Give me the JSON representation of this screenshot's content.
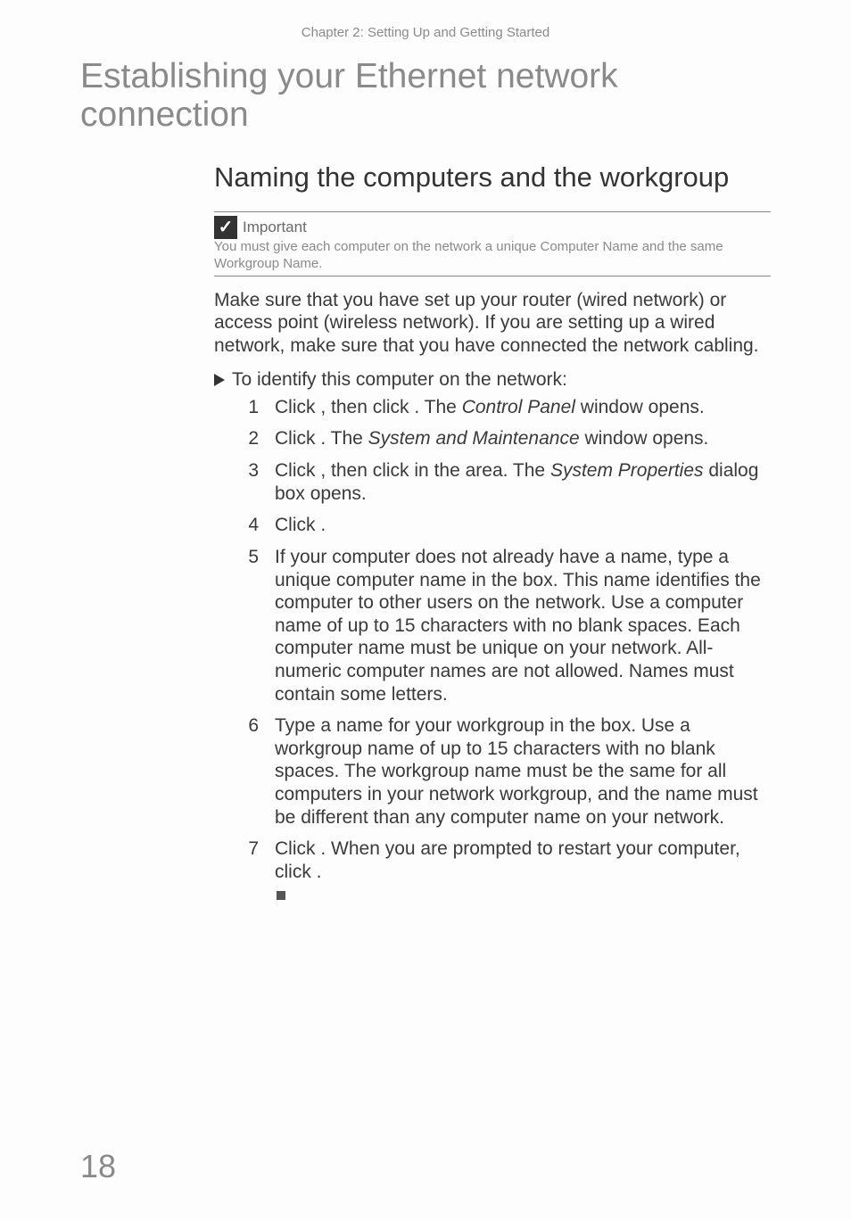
{
  "header": "Chapter 2: Setting Up and Getting Started",
  "h1": "Establishing your Ethernet network connection",
  "h2": "Naming the computers and the workgroup",
  "callout": {
    "title": "Important",
    "body": "You must give each computer on the network a unique Computer Name and the same Workgroup Name."
  },
  "intro": "Make sure that you have set up your router (wired network) or access point (wireless network). If you are setting up a wired network, make sure that you have connected the network cabling.",
  "procedure_head": "To identify this computer on the network:",
  "steps": {
    "s1_a": "Click ",
    "s1_b": ", then click ",
    "s1_c": ". The ",
    "s1_italic1": "Control Panel",
    "s1_d": " window opens.",
    "s2_a": "Click ",
    "s2_b": ". The ",
    "s2_italic1": "System and Maintenance",
    "s2_c": " window opens.",
    "s3_a": "Click ",
    "s3_b": ", then click ",
    "s3_c": " in the ",
    "s3_d": " area. The ",
    "s3_italic1": "System Properties",
    "s3_e": " dialog box opens.",
    "s4_a": "Click ",
    "s4_b": ".",
    "s5": "If your computer does not already have a name, type a unique computer name in the  box. This name identifies the computer to other users on the network. Use a computer name of up to 15 characters with no blank spaces. Each computer name must be unique on your network. All-numeric computer names are not allowed. Names must contain some letters.",
    "s6": "Type a name for your workgroup in the  box. Use a workgroup name of up to 15 characters with no blank spaces. The workgroup name must be the same for all computers in your network workgroup, and the name must be different than any computer name on your network.",
    "s7_a": "Click ",
    "s7_b": ". When you are prompted to restart your computer, click ",
    "s7_c": "."
  },
  "page_number": "18"
}
